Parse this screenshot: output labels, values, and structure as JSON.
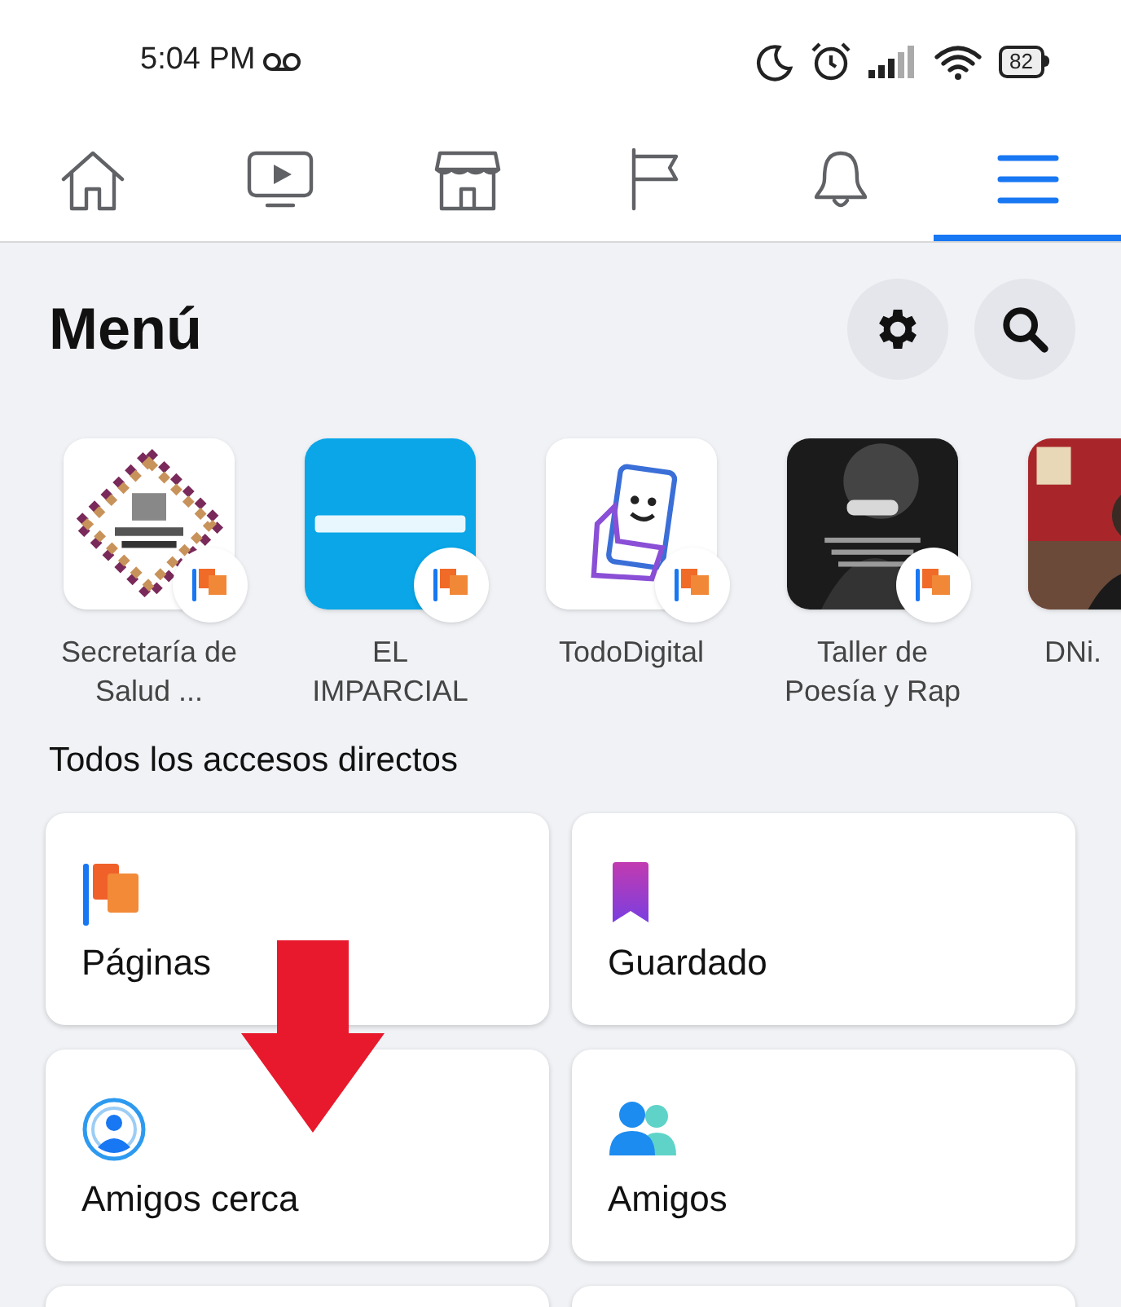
{
  "status_bar": {
    "time": "5:04 PM",
    "battery": "82"
  },
  "tabs": [
    {
      "kind": "home",
      "selected": false
    },
    {
      "kind": "video",
      "selected": false
    },
    {
      "kind": "store",
      "selected": false
    },
    {
      "kind": "flag",
      "selected": false
    },
    {
      "kind": "bell",
      "selected": false
    },
    {
      "kind": "menu",
      "selected": true
    }
  ],
  "title": "Menú",
  "shortcuts": [
    {
      "label": "Secretaría de Salud ...",
      "kind": "diamond",
      "badge": true
    },
    {
      "label": "EL IMPARCIAL",
      "kind": "blue",
      "badge": true
    },
    {
      "label": "TodoDigital",
      "kind": "phone",
      "badge": true
    },
    {
      "label": "Taller de Poesía y Rap",
      "kind": "dark",
      "badge": true
    },
    {
      "label": "DNi.",
      "kind": "red",
      "badge": false
    }
  ],
  "section_title": "Todos los accesos directos",
  "cards": [
    {
      "label": "Páginas",
      "kind": "flags"
    },
    {
      "label": "Guardado",
      "kind": "bookmark"
    },
    {
      "label": "Amigos cerca",
      "kind": "radar"
    },
    {
      "label": "Amigos",
      "kind": "friends"
    }
  ]
}
